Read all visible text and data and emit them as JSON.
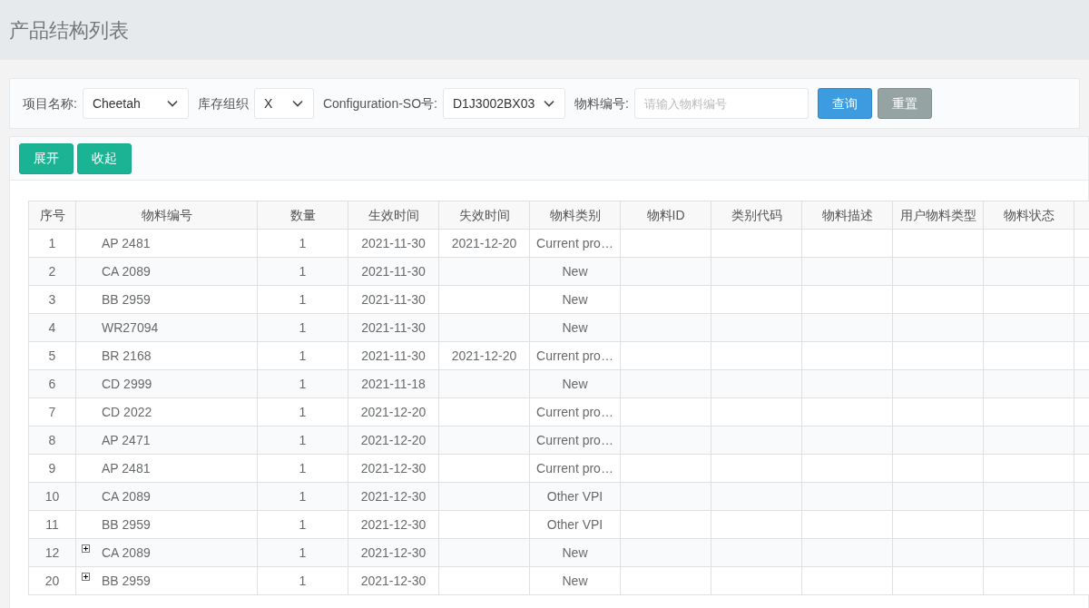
{
  "page_title": "产品结构列表",
  "filters": [
    {
      "kind": "select",
      "label": "项目名称:",
      "value": "Cheetah"
    },
    {
      "kind": "select",
      "label": "库存组织",
      "value": "X"
    },
    {
      "kind": "select",
      "label": "Configuration-SO号:",
      "value": "D1J3002BX03"
    },
    {
      "kind": "input",
      "label": "物料编号:",
      "placeholder": "请输入物料编号"
    }
  ],
  "search_button": "查询",
  "reset_button": "重置",
  "toolbar_buttons": [
    "展开",
    "收起"
  ],
  "table": {
    "columns": [
      "序号",
      "物料编号",
      "数量",
      "生效时间",
      "失效时间",
      "物料类别",
      "物料ID",
      "类别代码",
      "物料描述",
      "用户物料类型",
      "物料状态"
    ],
    "rows": [
      {
        "cells": [
          "1",
          "AP 2481",
          "1",
          "2021-11-30",
          "2021-12-20",
          "Current pro…"
        ],
        "has_children": false
      },
      {
        "cells": [
          "2",
          "CA 2089",
          "1",
          "2021-11-30",
          "",
          "New"
        ],
        "has_children": false
      },
      {
        "cells": [
          "3",
          "BB 2959",
          "1",
          "2021-11-30",
          "",
          "New"
        ],
        "has_children": false
      },
      {
        "cells": [
          "4",
          "WR27094",
          "1",
          "2021-11-30",
          "",
          "New"
        ],
        "has_children": false
      },
      {
        "cells": [
          "5",
          "BR 2168",
          "1",
          "2021-11-30",
          "2021-12-20",
          "Current pro…"
        ],
        "has_children": false
      },
      {
        "cells": [
          "6",
          "CD 2999",
          "1",
          "2021-11-18",
          "",
          "New"
        ],
        "has_children": false
      },
      {
        "cells": [
          "7",
          "CD 2022",
          "1",
          "2021-12-20",
          "",
          "Current pro…"
        ],
        "has_children": false
      },
      {
        "cells": [
          "8",
          "AP 2471",
          "1",
          "2021-12-20",
          "",
          "Current pro…"
        ],
        "has_children": false
      },
      {
        "cells": [
          "9",
          "AP 2481",
          "1",
          "2021-12-30",
          "",
          "Current pro…"
        ],
        "has_children": false
      },
      {
        "cells": [
          "10",
          "CA 2089",
          "1",
          "2021-12-30",
          "",
          "Other VPI"
        ],
        "has_children": false
      },
      {
        "cells": [
          "11",
          "BB 2959",
          "1",
          "2021-12-30",
          "",
          "Other VPI"
        ],
        "has_children": false
      },
      {
        "cells": [
          "12",
          "CA 2089",
          "1",
          "2021-12-30",
          "",
          "New"
        ],
        "has_children": true
      },
      {
        "cells": [
          "20",
          "BB 2959",
          "1",
          "2021-12-30",
          "",
          "New"
        ],
        "has_children": true
      }
    ]
  }
}
